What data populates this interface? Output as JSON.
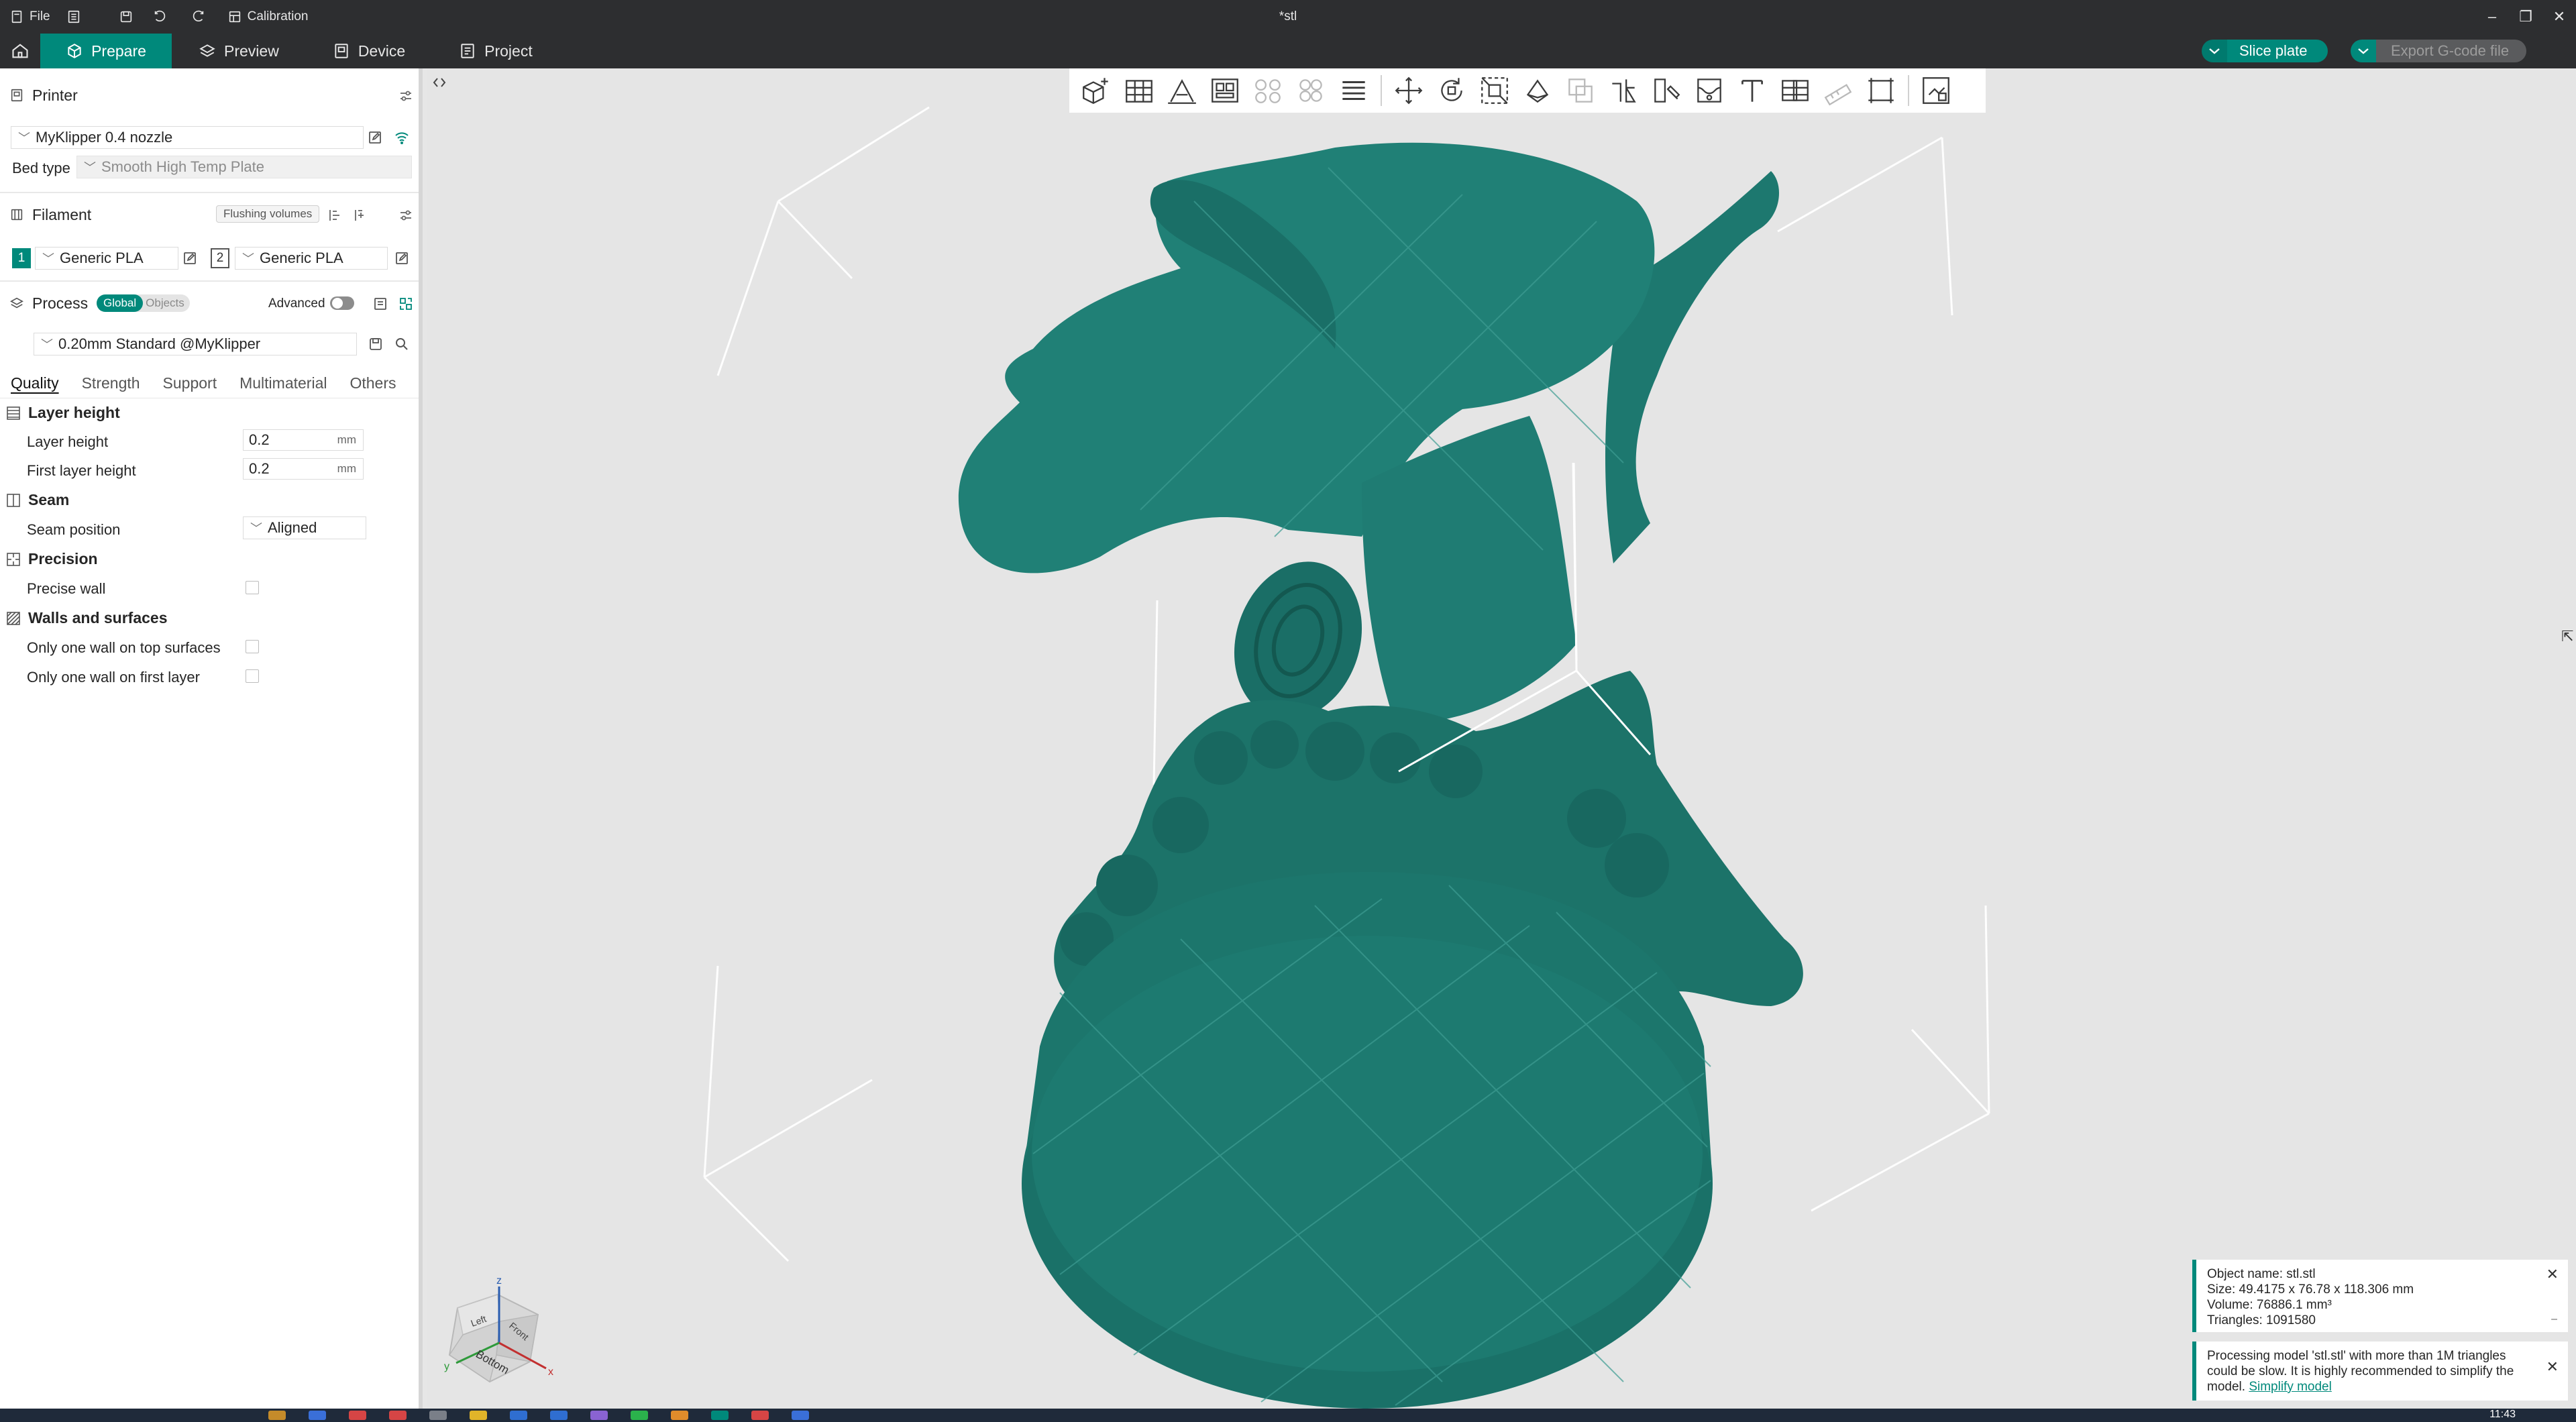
{
  "window": {
    "title": "*stl",
    "menu_file": "File",
    "calibration": "Calibration"
  },
  "nav": {
    "tabs": [
      {
        "label": "Prepare"
      },
      {
        "label": "Preview"
      },
      {
        "label": "Device"
      },
      {
        "label": "Project"
      }
    ],
    "slice_label": "Slice plate",
    "export_label": "Export G-code file"
  },
  "printer": {
    "section_label": "Printer",
    "name": "MyKlipper 0.4 nozzle",
    "bed_type_label": "Bed type",
    "bed_type_value": "Smooth High Temp Plate"
  },
  "filament": {
    "section_label": "Filament",
    "flushing_label": "Flushing volumes",
    "slots": [
      {
        "index": "1",
        "name": "Generic PLA",
        "color": "#00897b"
      },
      {
        "index": "2",
        "name": "Generic PLA",
        "color": "#ffffff"
      }
    ]
  },
  "process": {
    "section_label": "Process",
    "global_label": "Global",
    "objects_label": "Objects",
    "advanced_label": "Advanced",
    "preset": "0.20mm Standard @MyKlipper"
  },
  "subtabs": [
    "Quality",
    "Strength",
    "Support",
    "Multimaterial",
    "Others"
  ],
  "settings": {
    "layer_height_group": "Layer height",
    "layer_height_label": "Layer height",
    "layer_height_value": "0.2",
    "first_layer_height_label": "First layer height",
    "first_layer_height_value": "0.2",
    "unit_mm": "mm",
    "seam_group": "Seam",
    "seam_position_label": "Seam position",
    "seam_position_value": "Aligned",
    "precision_group": "Precision",
    "precise_wall_label": "Precise wall",
    "walls_group": "Walls and surfaces",
    "top_wall_label": "Only one wall on top surfaces",
    "first_layer_wall_label": "Only one wall on first layer"
  },
  "view_cube": {
    "face_label": "Bottom",
    "left_label": "Left",
    "front_label": "Front",
    "axis_z": "z",
    "axis_y": "y",
    "axis_x": "x"
  },
  "object_info": {
    "name": "Object name: stl.stl",
    "size": "Size: 49.4175 x 76.78 x 118.306 mm",
    "volume": "Volume: 76886.1 mm³",
    "triangles": "Triangles: 1091580"
  },
  "warning": {
    "text": "Processing model 'stl.stl' with more than 1M triangles could be slow. It is highly recommended to simplify the model.",
    "link": "Simplify model"
  },
  "taskbar": {
    "clock": "11:43"
  },
  "colors": {
    "accent": "#00897b",
    "model": "#1f7a72",
    "chrome": "#2d2e30"
  }
}
